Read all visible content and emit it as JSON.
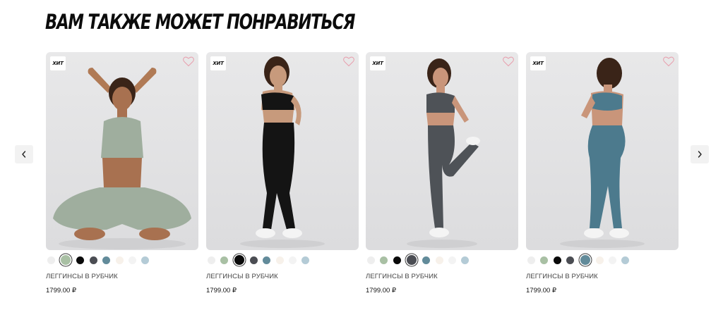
{
  "section": {
    "title": "ВАМ ТАКЖЕ МОЖЕТ ПОНРАВИТЬСЯ"
  },
  "carousel": {
    "prev_icon": "chevron-left-icon",
    "next_icon": "chevron-right-icon"
  },
  "products": [
    {
      "badge": "ХИТ",
      "name": "ЛЕГГИНСЫ В РУБЧИК",
      "price": "1799.00 ₽",
      "favorite_icon": "heart-outline-icon",
      "outfit_color": "#9fae9e",
      "swatches": [
        "#eeeeee",
        "#a9c0a4",
        "#0a0a0a",
        "#4b4d53",
        "#628b9a",
        "#f7f1ea",
        "#f3f3f3",
        "#b4cbd6"
      ],
      "selected_swatch": 1
    },
    {
      "badge": "ХИТ",
      "name": "ЛЕГГИНСЫ В РУБЧИК",
      "price": "1799.00 ₽",
      "favorite_icon": "heart-outline-icon",
      "outfit_color": "#141414",
      "swatches": [
        "#eeeeee",
        "#a9c0a4",
        "#0a0a0a",
        "#4b4d53",
        "#628b9a",
        "#f7f1ea",
        "#f3f3f3",
        "#b4cbd6"
      ],
      "selected_swatch": 2
    },
    {
      "badge": "ХИТ",
      "name": "ЛЕГГИНСЫ В РУБЧИК",
      "price": "1799.00 ₽",
      "favorite_icon": "heart-outline-icon",
      "outfit_color": "#4e5257",
      "swatches": [
        "#eeeeee",
        "#a9c0a4",
        "#0a0a0a",
        "#4b4d53",
        "#628b9a",
        "#f7f1ea",
        "#f3f3f3",
        "#b4cbd6"
      ],
      "selected_swatch": 3
    },
    {
      "badge": "ХИТ",
      "name": "ЛЕГГИНСЫ В РУБЧИК",
      "price": "1799.00 ₽",
      "favorite_icon": "heart-outline-icon",
      "outfit_color": "#4c7a8d",
      "swatches": [
        "#eeeeee",
        "#a9c0a4",
        "#0a0a0a",
        "#4b4d53",
        "#628b9a",
        "#f7f1ea",
        "#f3f3f3",
        "#b4cbd6"
      ],
      "selected_swatch": 4
    }
  ],
  "colors": {
    "heart": "#e8a0ae",
    "selected_ring": "#3a3a3a"
  }
}
